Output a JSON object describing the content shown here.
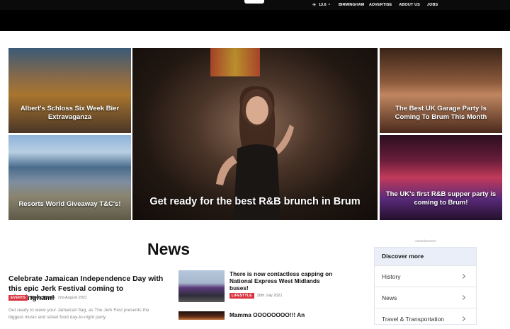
{
  "header": {
    "weather": {
      "icon": "sun-icon",
      "temperature": "13.6",
      "unit": "c",
      "city": "BIRMINGHAM"
    },
    "nav": [
      "ADVERTISE",
      "ABOUT US",
      "JOBS"
    ]
  },
  "hero": {
    "tiles": [
      {
        "caption": "Albert's Schloss Six Week Bier Extravaganza"
      },
      {
        "caption": "Resorts World Giveaway T&C's!"
      },
      {
        "caption": "Get ready for the best R&B brunch in Brum"
      },
      {
        "caption": "The Best UK Garage Party Is Coming To Brum This Month"
      },
      {
        "caption": "The UK's first R&B supper party is coming to Brum!"
      }
    ]
  },
  "news": {
    "heading": "News",
    "feature": {
      "title": "Celebrate Jamaican Independence Day with this epic Jerk Festival coming to Birmingham!",
      "tag": "EVENTS",
      "author": "Taylor Rooke",
      "date": "2nd August 2021",
      "excerpt": "Get ready to wave your Jamaican flag, as The Jerk Fest presents the biggest music and street food day-to-night party"
    },
    "stories": [
      {
        "title": "There is now contactless capping on National Express West Midlands buses!",
        "tag": "LIFESTYLE",
        "date": "30th July 2021"
      },
      {
        "title": "Mamma OOOOOOOO!!! An",
        "tag": "",
        "date": ""
      }
    ]
  },
  "sidebar": {
    "ad_label": "- Advertisement -",
    "discover": {
      "heading": "Discover more",
      "items": [
        "History",
        "News",
        "Travel & Transportation"
      ]
    }
  }
}
